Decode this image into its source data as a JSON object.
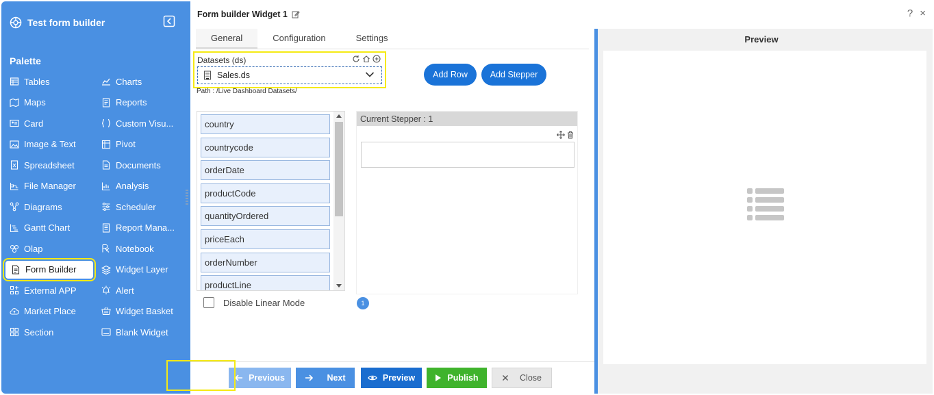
{
  "sidebar": {
    "app_title": "Test form builder",
    "palette_label": "Palette",
    "items": [
      {
        "label": "Tables",
        "icon": "table-icon"
      },
      {
        "label": "Charts",
        "icon": "charts-icon"
      },
      {
        "label": "Maps",
        "icon": "map-icon"
      },
      {
        "label": "Reports",
        "icon": "report-icon"
      },
      {
        "label": "Card",
        "icon": "card-icon"
      },
      {
        "label": "Custom Visu...",
        "icon": "custom-visual-icon"
      },
      {
        "label": "Image & Text",
        "icon": "image-icon"
      },
      {
        "label": "Pivot",
        "icon": "pivot-icon"
      },
      {
        "label": "Spreadsheet",
        "icon": "spreadsheet-icon"
      },
      {
        "label": "Documents",
        "icon": "document-icon"
      },
      {
        "label": "File Manager",
        "icon": "file-manager-icon"
      },
      {
        "label": "Analysis",
        "icon": "analysis-icon"
      },
      {
        "label": "Diagrams",
        "icon": "diagram-icon"
      },
      {
        "label": "Scheduler",
        "icon": "scheduler-icon"
      },
      {
        "label": "Gantt Chart",
        "icon": "gantt-icon"
      },
      {
        "label": "Report Mana...",
        "icon": "report-manager-icon"
      },
      {
        "label": "Olap",
        "icon": "olap-icon"
      },
      {
        "label": "Notebook",
        "icon": "notebook-icon"
      },
      {
        "label": "Form Builder",
        "icon": "form-builder-icon"
      },
      {
        "label": "Widget Layer",
        "icon": "layers-icon"
      },
      {
        "label": "External APP",
        "icon": "external-app-icon"
      },
      {
        "label": "Alert",
        "icon": "alert-icon"
      },
      {
        "label": "Market Place",
        "icon": "cloud-icon"
      },
      {
        "label": "Widget Basket",
        "icon": "basket-icon"
      },
      {
        "label": "Section",
        "icon": "section-icon"
      },
      {
        "label": "Blank Widget",
        "icon": "blank-widget-icon"
      }
    ]
  },
  "widget": {
    "title": "Form builder Widget 1",
    "tabs": [
      "General",
      "Configuration",
      "Settings"
    ],
    "active_tab": "General"
  },
  "datasets": {
    "label": "Datasets (ds)",
    "selected": "Sales.ds",
    "path": "Path : /Live Dashboard Datasets/"
  },
  "actions": {
    "add_row": "Add Row",
    "add_stepper": "Add Stepper"
  },
  "fields": [
    "country",
    "countrycode",
    "orderDate",
    "productCode",
    "quantityOrdered",
    "priceEach",
    "orderNumber",
    "productLine"
  ],
  "stepper": {
    "header": "Current Stepper : 1",
    "badge": "1"
  },
  "linear_mode_label": "Disable Linear Mode",
  "footer": {
    "previous": "Previous",
    "next": "Next",
    "preview": "Preview",
    "publish": "Publish",
    "close": "Close"
  },
  "preview_panel": {
    "title": "Preview"
  },
  "window": {
    "help": "?",
    "close": "×"
  },
  "colors": {
    "sidebar": "#4a90e2",
    "primary_button": "#1a73d8",
    "publish": "#3fb32c",
    "highlight": "#f5ea14"
  }
}
